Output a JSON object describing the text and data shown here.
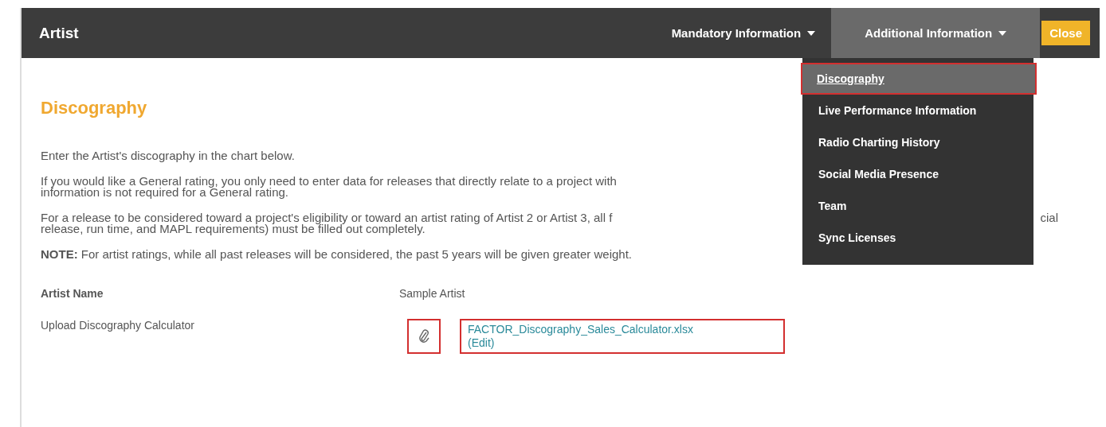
{
  "header": {
    "title": "Artist",
    "nav": [
      {
        "label": "Mandatory Information",
        "selected": false
      },
      {
        "label": "Additional Information",
        "selected": true
      }
    ],
    "close": "Close"
  },
  "dropdown": [
    {
      "label": "Discography",
      "selected": true
    },
    {
      "label": "Live Performance Information",
      "selected": false
    },
    {
      "label": "Radio Charting History",
      "selected": false
    },
    {
      "label": "Social Media Presence",
      "selected": false
    },
    {
      "label": "Team",
      "selected": false
    },
    {
      "label": "Sync Licenses",
      "selected": false
    }
  ],
  "heading": "Discography",
  "paragraphs": [
    {
      "lines": [
        {
          "left": "Enter the Artist's discography in the chart below."
        }
      ]
    },
    {
      "lines": [
        {
          "left": "If you would like a General rating, you only need to enter data for releases that directly relate to a project with"
        },
        {
          "left": "information is not required for a General rating."
        }
      ]
    },
    {
      "lines": [
        {
          "left": "For a release to be considered toward a project's eligibility or toward an artist rating of Artist 2 or Artist 3, all f",
          "right": "cial"
        },
        {
          "left": "release, run time, and MAPL requirements) must be filled out completely."
        }
      ]
    },
    {
      "lines": [
        {
          "left": "**NOTE:** For artist ratings, while all past releases will be considered, the past 5 years will be given greater weight."
        }
      ]
    }
  ],
  "fields": [
    {
      "label": "Artist Name",
      "kind": "text",
      "value": "Sample Artist"
    },
    {
      "label": "Upload Discography Calculator",
      "kind": "file",
      "file": "FACTOR_Discography_Sales_Calculator.xlsx",
      "edit": "(Edit)"
    }
  ]
}
